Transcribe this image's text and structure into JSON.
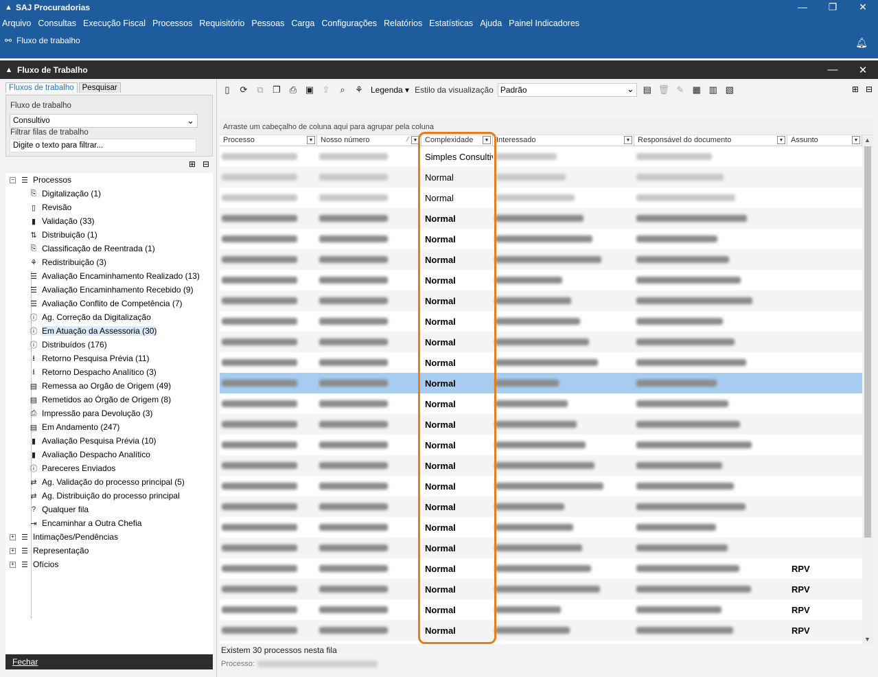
{
  "app": {
    "title": "SAJ Procuradorias",
    "window_controls": [
      "—",
      "❐",
      "✕"
    ]
  },
  "menu": [
    "Arquivo",
    "Consultas",
    "Execução Fiscal",
    "Processos",
    "Requisitório",
    "Pessoas",
    "Carga",
    "Configurações",
    "Relatórios",
    "Estatísticas",
    "Ajuda",
    "Painel Indicadores"
  ],
  "breadcrumb": {
    "label": "Fluxo de trabalho"
  },
  "panel": {
    "title": "Fluxo de Trabalho",
    "controls": [
      "—",
      "✕"
    ]
  },
  "left": {
    "tabs": [
      "Fluxos de trabalho",
      "Pesquisar"
    ],
    "fluxo_label": "Fluxo de trabalho",
    "fluxo_value": "Consultivo",
    "filtro_label": "Filtrar filas de trabalho",
    "filtro_placeholder": "Digite o texto para filtrar...",
    "root": "Processos",
    "items": [
      "Digitalização (1)",
      "Revisão",
      "Validação (33)",
      "Distribuição (1)",
      "Classificação de Reentrada (1)",
      "Redistribuição (3)",
      "Avaliação Encaminhamento Realizado (13)",
      "Avaliação Encaminhamento Recebido (9)",
      "Avaliação Conflito de Competência (7)",
      "Ag. Correção da Digitalização",
      "Em Atuação da Assessoria (30)",
      "Distribuídos (176)",
      "Retorno Pesquisa Prévia (11)",
      "Retorno Despacho Analítico (3)",
      "Remessa ao Orgão de Origem (49)",
      "Remetidos ao Órgão de Origem (8)",
      "Impressão para Devolução (3)",
      "Em Andamento (247)",
      "Avaliação Pesquisa Prévia (10)",
      "Avaliação Despacho Analítico",
      "Pareceres Enviados",
      "Ag. Validação do processo principal (5)",
      "Ag. Distribuição do processo principal",
      "Qualquer fila",
      "Encaminhar a Outra Chefia"
    ],
    "others": [
      "Intimações/Pendências",
      "Representação",
      "Ofícios"
    ],
    "close_button": "Fechar"
  },
  "toolbar": {
    "legenda": "Legenda",
    "estilo_label": "Estilo da visualização",
    "estilo_value": "Padrão"
  },
  "grid": {
    "group_hint": "Arraste um cabeçalho de coluna aqui para agrupar pela coluna",
    "columns": [
      "Processo",
      "Nosso número",
      "Complexidade",
      "Interessado",
      "Responsável do documento",
      "Assunto"
    ],
    "rows": [
      {
        "complexidade": "Simples Consultivo",
        "assunto": "",
        "bold": false
      },
      {
        "complexidade": "Normal",
        "assunto": "",
        "bold": false
      },
      {
        "complexidade": "Normal",
        "assunto": "",
        "bold": false
      },
      {
        "complexidade": "Normal",
        "assunto": "",
        "bold": true
      },
      {
        "complexidade": "Normal",
        "assunto": "",
        "bold": true
      },
      {
        "complexidade": "Normal",
        "assunto": "",
        "bold": true
      },
      {
        "complexidade": "Normal",
        "assunto": "",
        "bold": true
      },
      {
        "complexidade": "Normal",
        "assunto": "",
        "bold": true
      },
      {
        "complexidade": "Normal",
        "assunto": "",
        "bold": true
      },
      {
        "complexidade": "Normal",
        "assunto": "",
        "bold": true
      },
      {
        "complexidade": "Normal",
        "assunto": "",
        "bold": true
      },
      {
        "complexidade": "Normal",
        "assunto": "",
        "bold": true
      },
      {
        "complexidade": "Normal",
        "assunto": "",
        "bold": true
      },
      {
        "complexidade": "Normal",
        "assunto": "",
        "bold": true
      },
      {
        "complexidade": "Normal",
        "assunto": "",
        "bold": true
      },
      {
        "complexidade": "Normal",
        "assunto": "",
        "bold": true
      },
      {
        "complexidade": "Normal",
        "assunto": "",
        "bold": true
      },
      {
        "complexidade": "Normal",
        "assunto": "",
        "bold": true
      },
      {
        "complexidade": "Normal",
        "assunto": "",
        "bold": true
      },
      {
        "complexidade": "Normal",
        "assunto": "",
        "bold": true
      },
      {
        "complexidade": "Normal",
        "assunto": "RPV",
        "bold": true
      },
      {
        "complexidade": "Normal",
        "assunto": "RPV",
        "bold": true
      },
      {
        "complexidade": "Normal",
        "assunto": "RPV",
        "bold": true
      },
      {
        "complexidade": "Normal",
        "assunto": "RPV",
        "bold": true
      }
    ],
    "selected_row": 11
  },
  "status": {
    "count_text": "Existem 30 processos nesta fila",
    "processo_label": "Processo:"
  },
  "colors": {
    "title_blue": "#1f5c9e",
    "dark_bar": "#2d2d30",
    "selected_row": "#a6cdf0",
    "highlight": "#e07f1c"
  }
}
